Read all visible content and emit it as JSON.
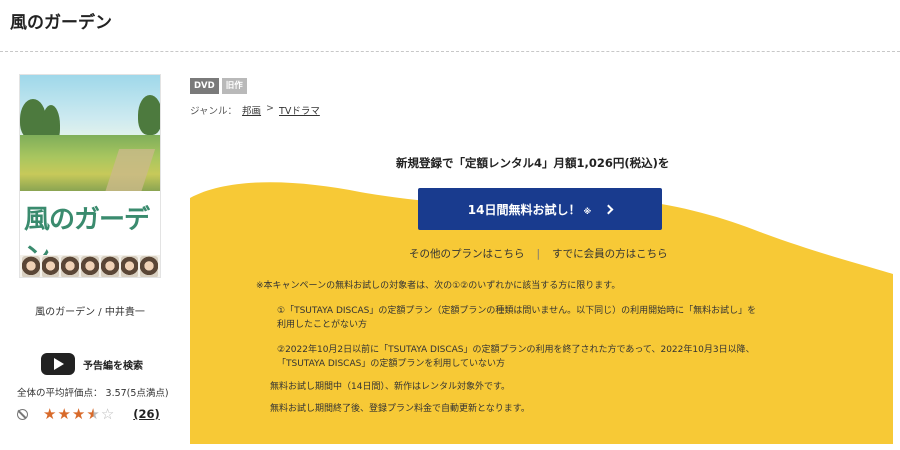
{
  "page": {
    "title": "風のガーデン"
  },
  "cover": {
    "logo_text": "風のガーデン",
    "caption": "風のガーデン / 中井貴一"
  },
  "trailer": {
    "label": "予告編を検索"
  },
  "rating": {
    "average_text": "全体の平均評価点： 3.57(5点満点)",
    "average_value": 3.57,
    "max": 5,
    "review_count": "(26)"
  },
  "tags": {
    "format": "DVD",
    "status": "旧作"
  },
  "genre": {
    "label": "ジャンル：",
    "items": [
      "邦画",
      "TVドラマ"
    ],
    "separator": ">"
  },
  "campaign": {
    "headline": "新規登録で「定額レンタル4」月額1,026円(税込)を",
    "cta_label": "14日間無料お試し！",
    "cta_note": "※",
    "other_plans": "その他のプランはこちら",
    "separator": "|",
    "member_link": "すでに会員の方はこちら",
    "notes": [
      "※本キャンペーンの無料お試しの対象者は、次の①②のいずれかに該当する方に限ります。",
      "①「TSUTAYA DISCAS」の定額プラン（定額プランの種類は問いません。以下同じ）の利用開始時に「無料お試し」を",
      "利用したことがない方",
      "②2022年10月2日以前に「TSUTAYA DISCAS」の定額プランの利用を終了された方であって、2022年10月3日以降、",
      "「TSUTAYA DISCAS」の定額プランを利用していない方",
      "無料お試し期間中（14日間）、新作はレンタル対象外です。",
      "無料お試し期間終了後、登録プラン料金で自動更新となります。"
    ]
  },
  "colors": {
    "campaign_bg": "#f7c936",
    "cta_bg": "#193b8e",
    "star": "#d86a2a"
  }
}
